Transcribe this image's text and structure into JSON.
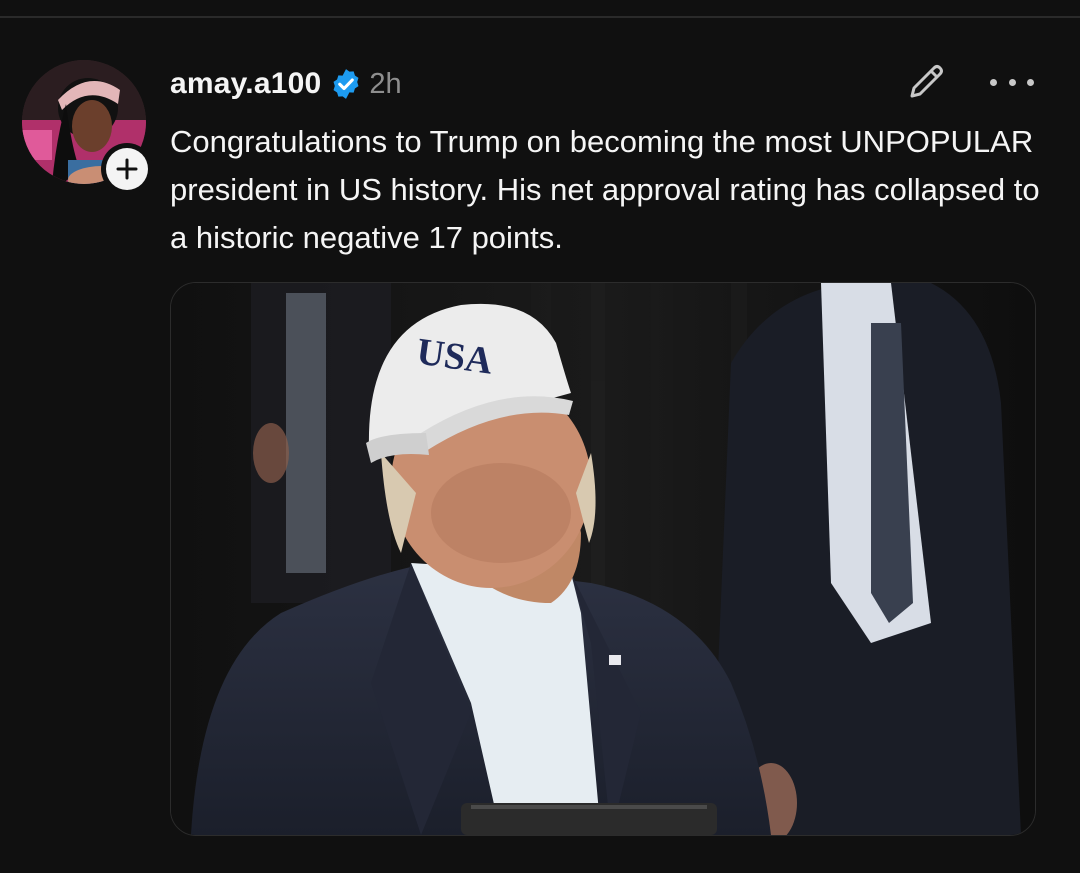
{
  "post": {
    "username": "amay.a100",
    "verified": true,
    "timestamp": "2h",
    "text": "Congratulations to Trump on becoming the most UNPOPULAR president in US history. His net approval rating has collapsed to a historic negative 17 points.",
    "image": {
      "cap_text": "USA"
    }
  },
  "icons": {
    "verified": "verified-badge-icon",
    "edit": "pencil-icon",
    "more": "more-horizontal-icon",
    "follow": "plus-icon"
  },
  "colors": {
    "background": "#101010",
    "verified_blue": "#1d9bf0",
    "timestamp_gray": "#8e8e8e"
  }
}
